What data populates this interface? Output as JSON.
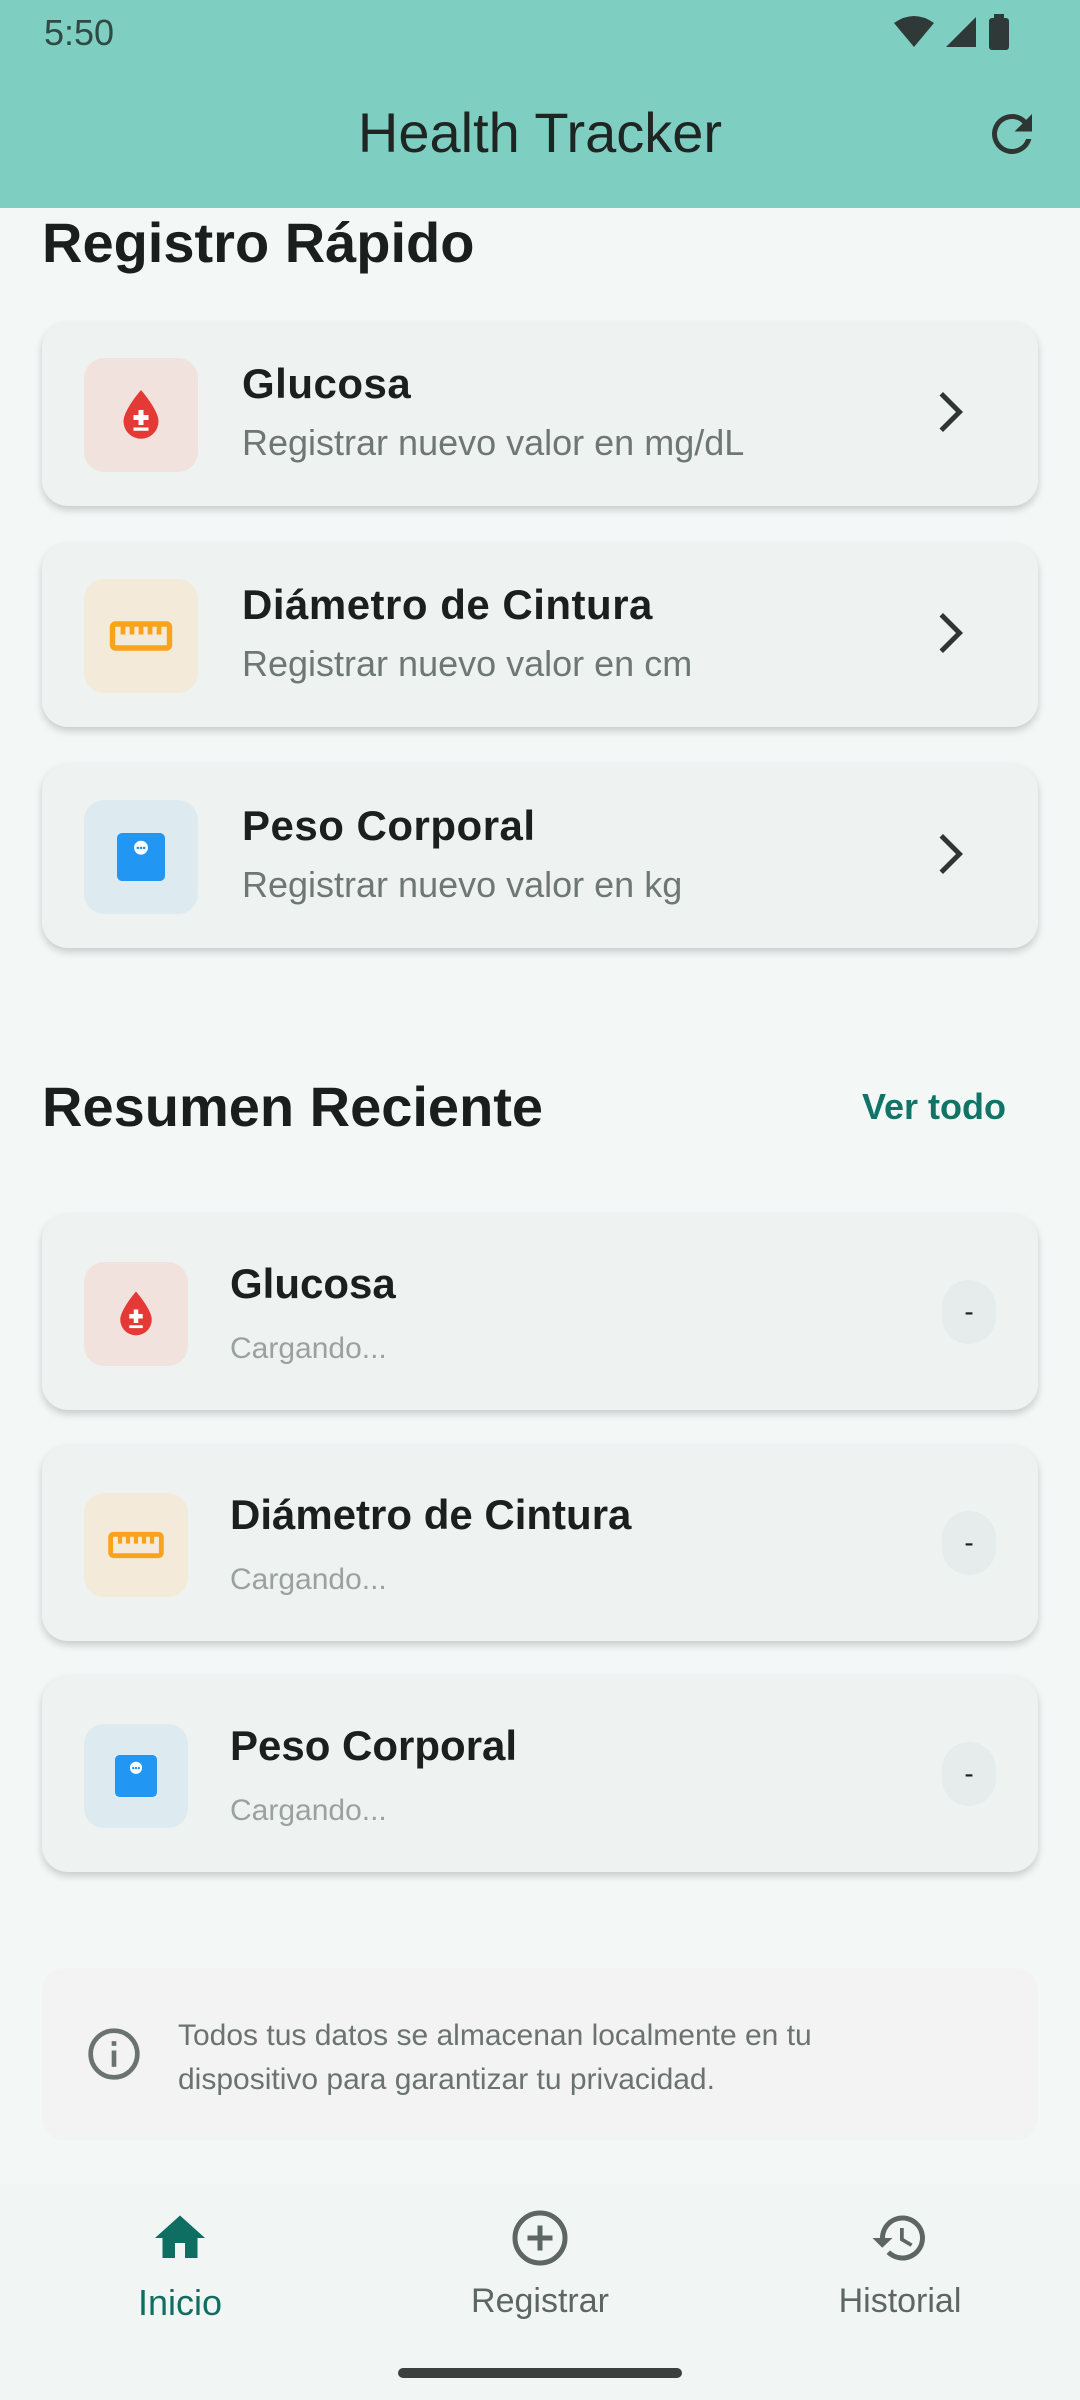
{
  "status": {
    "time": "5:50"
  },
  "app": {
    "title": "Health Tracker"
  },
  "quick": {
    "heading": "Registro Rápido",
    "items": [
      {
        "title": "Glucosa",
        "subtitle": "Registrar nuevo valor en mg/dL",
        "icon": "blood-drop-icon",
        "color": "#E53935"
      },
      {
        "title": "Diámetro de Cintura",
        "subtitle": "Registrar nuevo valor en cm",
        "icon": "ruler-icon",
        "color": "#F9A21B"
      },
      {
        "title": "Peso Corporal",
        "subtitle": "Registrar nuevo valor en kg",
        "icon": "scale-icon",
        "color": "#2196F3"
      }
    ]
  },
  "summary": {
    "heading": "Resumen Reciente",
    "see_all": "Ver todo",
    "items": [
      {
        "title": "Glucosa",
        "status": "Cargando...",
        "value": "-"
      },
      {
        "title": "Diámetro de Cintura",
        "status": "Cargando...",
        "value": "-"
      },
      {
        "title": "Peso Corporal",
        "status": "Cargando...",
        "value": "-"
      }
    ]
  },
  "info": {
    "text": "Todos tus datos se almacenan localmente en tu dispositivo para garantizar tu privacidad."
  },
  "nav": {
    "items": [
      {
        "label": "Inicio",
        "icon": "home-icon",
        "active": true
      },
      {
        "label": "Registrar",
        "icon": "add-circle-icon",
        "active": false
      },
      {
        "label": "Historial",
        "icon": "history-icon",
        "active": false
      }
    ]
  },
  "colors": {
    "primary": "#7ECEC1",
    "accent": "#117466",
    "background": "#F3F8F7"
  }
}
